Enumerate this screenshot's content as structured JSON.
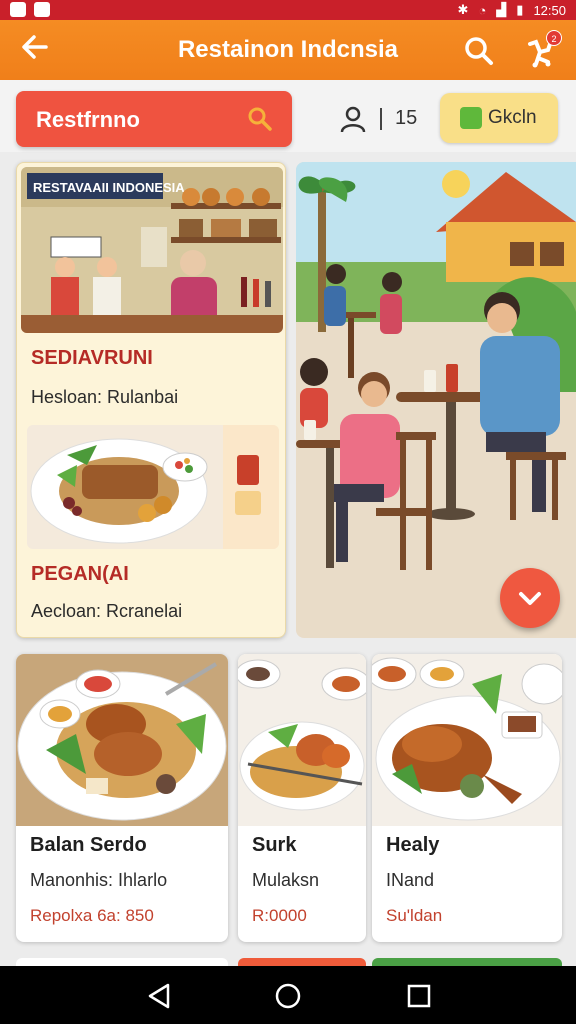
{
  "status_bar": {
    "time": "12:50"
  },
  "app_bar": {
    "back_icon": "arrow-left-icon",
    "title": "Restainon Indcnsia",
    "search_icon": "search-icon",
    "cart_icon": "cart-icon",
    "cart_badge": "2"
  },
  "search": {
    "value": "Restfrnno"
  },
  "toolbar": {
    "count": "15",
    "button_label": "Gkcln",
    "accent": "#ef5340"
  },
  "feature_card": {
    "shop_sign": "RESTAVAAII INDONESIA",
    "heading1": "SEDIAVRUNI",
    "sub1": "Hesloan: Rulanbai",
    "heading2": "PEGAN(AI",
    "sub2": "Aecloan: Rcranelai"
  },
  "items": [
    {
      "title": "Balan Serdo",
      "desc": "Manonhis: Ihlarlo",
      "price": "Repolxa 6a: 850"
    },
    {
      "title": "Surk",
      "desc": "Mulaksn",
      "price": "R:0000"
    },
    {
      "title": "Healy",
      "desc": "INand",
      "price": "Su'ldan"
    }
  ]
}
